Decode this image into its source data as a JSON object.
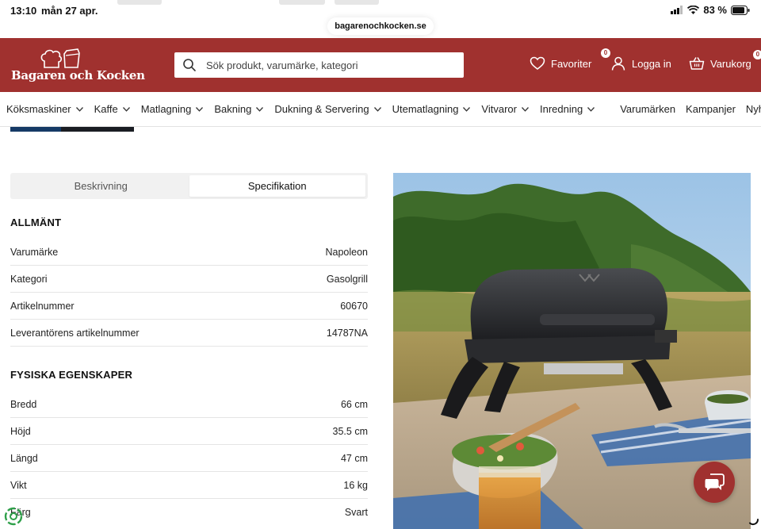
{
  "status_bar": {
    "time": "13:10",
    "date": "mån 27 apr.",
    "battery": "83 %"
  },
  "browser": {
    "url": "bagarenochkocken.se"
  },
  "header": {
    "logo_text": "Bagaren och Kocken",
    "search_placeholder": "Sök produkt, varumärke, kategori",
    "favorites_label": "Favoriter",
    "favorites_count": "0",
    "login_label": "Logga in",
    "cart_label": "Varukorg",
    "cart_count": "0",
    "brand_color": "#a0312f"
  },
  "nav": {
    "items": [
      {
        "label": "Köksmaskiner"
      },
      {
        "label": "Kaffe"
      },
      {
        "label": "Matlagning"
      },
      {
        "label": "Bakning"
      },
      {
        "label": "Dukning & Servering"
      },
      {
        "label": "Utematlagning"
      },
      {
        "label": "Vitvaror"
      },
      {
        "label": "Inredning"
      }
    ],
    "links": [
      {
        "label": "Varumärken"
      },
      {
        "label": "Kampanjer"
      },
      {
        "label": "Nyheter"
      }
    ]
  },
  "tabs": {
    "description": "Beskrivning",
    "specification": "Specifikation"
  },
  "specs": {
    "general_title": "ALLMÄNT",
    "general": [
      {
        "label": "Varumärke",
        "value": "Napoleon"
      },
      {
        "label": "Kategori",
        "value": "Gasolgrill"
      },
      {
        "label": "Artikelnummer",
        "value": "60670"
      },
      {
        "label": "Leverantörens artikelnummer",
        "value": "14787NA"
      }
    ],
    "physical_title": "FYSISKA EGENSKAPER",
    "physical": [
      {
        "label": "Bredd",
        "value": "66 cm"
      },
      {
        "label": "Höjd",
        "value": "35.5 cm"
      },
      {
        "label": "Längd",
        "value": "47 cm"
      },
      {
        "label": "Vikt",
        "value": "16 kg"
      },
      {
        "label": "Färg",
        "value": "Svart"
      }
    ]
  },
  "icons": {
    "search": "search-icon",
    "favorites": "heart-icon",
    "login": "user-icon",
    "cart": "basket-icon",
    "chat": "chat-icon",
    "eco": "recycle-icon"
  }
}
